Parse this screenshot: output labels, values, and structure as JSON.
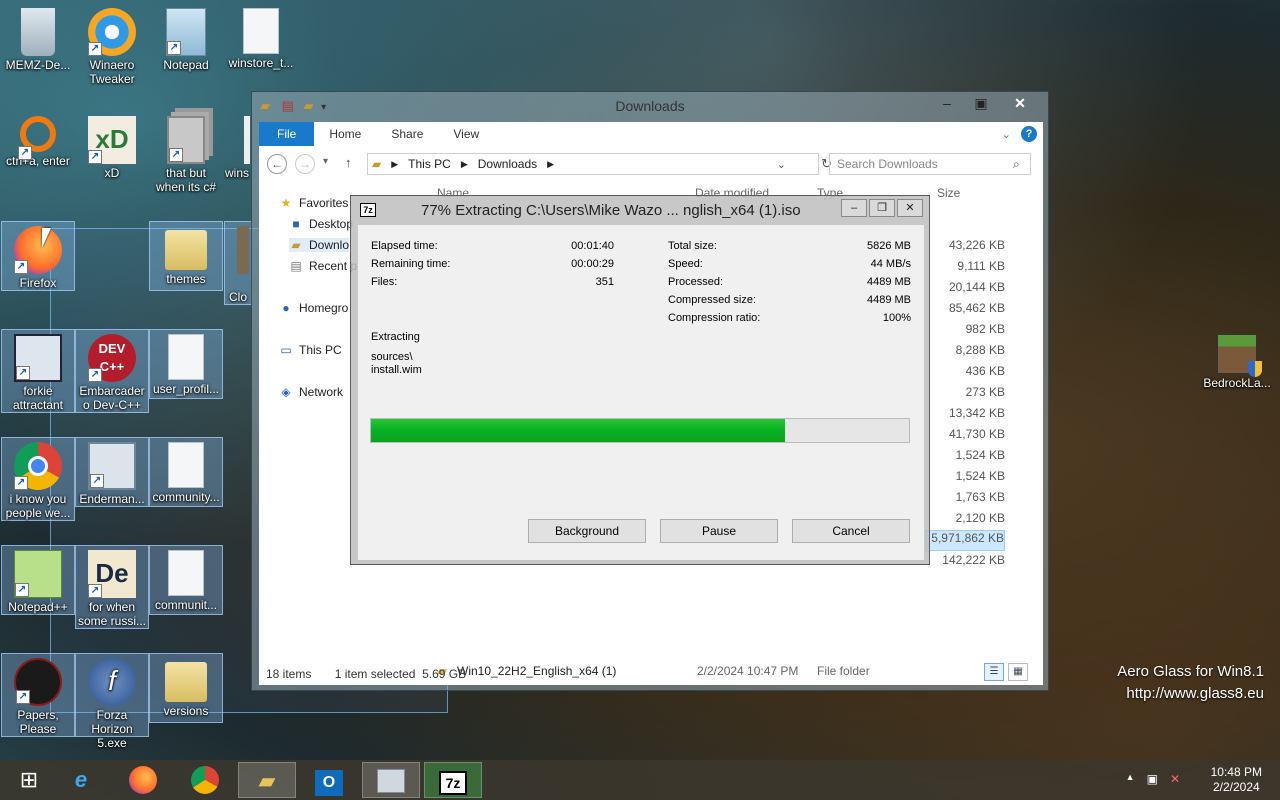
{
  "desktop": {
    "icons": [
      {
        "id": "memz",
        "label": "MEMZ-De..."
      },
      {
        "id": "winaero",
        "label": "Winaero Tweaker"
      },
      {
        "id": "notepad",
        "label": "Notepad"
      },
      {
        "id": "winstore",
        "label": "winstore_t..."
      },
      {
        "id": "ctrl",
        "label": "ctrl+a, enter"
      },
      {
        "id": "xd",
        "label": "xD"
      },
      {
        "id": "thatbut",
        "label": "that but when its c#"
      },
      {
        "id": "wins",
        "label": "wins"
      },
      {
        "id": "firefox",
        "label": "Firefox"
      },
      {
        "id": "themes",
        "label": "themes"
      },
      {
        "id": "clo",
        "label": "Clo"
      },
      {
        "id": "forkie",
        "label": "forkie attractant"
      },
      {
        "id": "devcpp",
        "label": "Embarcadero Dev-C++"
      },
      {
        "id": "userprofil",
        "label": "user_profil..."
      },
      {
        "id": "chrome",
        "label": "i know you people we..."
      },
      {
        "id": "enderman",
        "label": "Enderman..."
      },
      {
        "id": "community1",
        "label": "community..."
      },
      {
        "id": "notepadpp",
        "label": "Notepad++"
      },
      {
        "id": "forwhen",
        "label": "for when some russi..."
      },
      {
        "id": "community2",
        "label": "communit..."
      },
      {
        "id": "papers",
        "label": "Papers, Please"
      },
      {
        "id": "forza",
        "label": "Forza Horizon 5.exe"
      },
      {
        "id": "versions",
        "label": "versions"
      },
      {
        "id": "bedrock",
        "label": "BedrockLa..."
      }
    ]
  },
  "explorer": {
    "title": "Downloads",
    "tabs": {
      "file": "File",
      "home": "Home",
      "share": "Share",
      "view": "View"
    },
    "address": {
      "this_pc": "This PC",
      "folder": "Downloads"
    },
    "search_placeholder": "Search Downloads",
    "nav": {
      "favorites": "Favorites",
      "desktop": "Desktop",
      "downloads": "Downlo",
      "recent": "Recent p",
      "homegroup": "Homegro",
      "this_pc": "This PC",
      "network": "Network"
    },
    "columns": {
      "name": "Name",
      "date": "Date modified",
      "type": "Type",
      "size": "Size"
    },
    "sizes": [
      "43,226 KB",
      "9,111 KB",
      "20,144 KB",
      "85,462 KB",
      "982 KB",
      "8,288 KB",
      "436 KB",
      "273 KB",
      "13,342 KB",
      "41,730 KB",
      "1,524 KB",
      "1,524 KB",
      "1,763 KB",
      "2,120 KB",
      "5,971,862 KB",
      "142,222 KB"
    ],
    "folder_row": {
      "name": "Win10_22H2_English_x64 (1)",
      "date": "2/2/2024 10:47 PM",
      "type": "File folder"
    },
    "status": {
      "items": "18 items",
      "selected": "1 item selected  5.69 GB"
    }
  },
  "dialog": {
    "title": "77% Extracting C:\\Users\\Mike Wazo ... nglish_x64 (1).iso",
    "logo": "7z",
    "left_stats": [
      {
        "label": "Elapsed time:",
        "value": "00:01:40"
      },
      {
        "label": "Remaining time:",
        "value": "00:00:29"
      },
      {
        "label": "Files:",
        "value": "351"
      }
    ],
    "right_stats": [
      {
        "label": "Total size:",
        "value": "5826 MB"
      },
      {
        "label": "Speed:",
        "value": "44 MB/s"
      },
      {
        "label": "Processed:",
        "value": "4489 MB"
      },
      {
        "label": "Compressed size:",
        "value": "4489 MB"
      },
      {
        "label": "Compression ratio:",
        "value": "100%"
      }
    ],
    "operation": "Extracting",
    "path_line1": "sources\\",
    "path_line2": "install.wim",
    "progress_percent": 77,
    "buttons": {
      "background": "Background",
      "pause": "Pause",
      "cancel": "Cancel"
    }
  },
  "taskbar": {
    "clock_time": "10:48 PM",
    "clock_date": "2/2/2024",
    "active_item": "7z"
  },
  "watermark": {
    "line1": "Aero Glass for Win8.1",
    "line2": "http://www.glass8.eu"
  }
}
